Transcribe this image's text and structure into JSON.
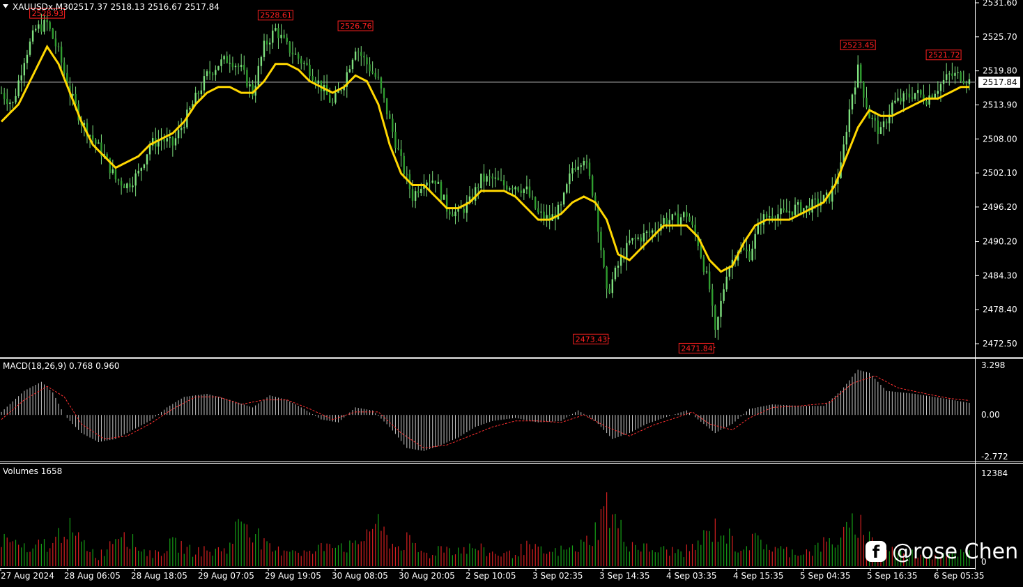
{
  "header": {
    "symbol": "XAUUSDx,M30",
    "ohlc": "2517.37 2518.13 2516.67 2517.84"
  },
  "colors": {
    "background": "#000000",
    "bull": "#2f9e2f",
    "candle": "#7ee07e",
    "ma": "#ffd700",
    "label_red": "#ff2020",
    "macd_hist": "#c8c8c8",
    "macd_signal": "#ff3030",
    "vol_up": "#16a016",
    "vol_down": "#d62020",
    "grid": "#ffffff"
  },
  "price_panel": {
    "axis_labels": [
      "2531.60",
      "2525.70",
      "2519.80",
      "2513.90",
      "2508.00",
      "2502.10",
      "2496.20",
      "2490.20",
      "2484.30",
      "2478.40",
      "2472.50"
    ],
    "current_price": "2517.84",
    "extremes": [
      {
        "label": "2528.93",
        "value": 2528.93,
        "index": 16
      },
      {
        "label": "2528.61",
        "value": 2528.61,
        "index": 96
      },
      {
        "label": "2526.76",
        "value": 2526.76,
        "index": 124
      },
      {
        "label": "2473.43",
        "value": 2473.43,
        "index": 213
      },
      {
        "label": "2471.84",
        "value": 2471.84,
        "index": 250
      },
      {
        "label": "2523.45",
        "value": 2523.45,
        "index": 300
      },
      {
        "label": "2521.72",
        "value": 2521.72,
        "index": 330
      }
    ]
  },
  "macd_panel": {
    "title": "MACD(18,26,9) 0.768 0.960",
    "axis_labels": [
      "3.298",
      "0.00",
      "-2.772"
    ]
  },
  "volume_panel": {
    "title": "Volumes 1658",
    "axis_labels": [
      "12384",
      "0"
    ]
  },
  "time_axis": [
    "27 Aug 2024",
    "28 Aug 06:05",
    "28 Aug 18:05",
    "29 Aug 07:05",
    "29 Aug 19:05",
    "30 Aug 08:05",
    "30 Aug 20:05",
    "2 Sep 10:05",
    "3 Sep 02:35",
    "3 Sep 14:35",
    "4 Sep 03:35",
    "4 Sep 15:35",
    "5 Sep 04:35",
    "5 Sep 16:35",
    "6 Sep 05:35"
  ],
  "watermark": {
    "icon": "facebook-icon",
    "text": "@rose Chen"
  },
  "chart_data": {
    "type": "line",
    "title": "XAUUSDx,M30",
    "ylim": [
      2469.0,
      2531.6
    ],
    "price_keypoints": [
      [
        0,
        2516
      ],
      [
        4,
        2514
      ],
      [
        8,
        2522
      ],
      [
        12,
        2527
      ],
      [
        16,
        2528
      ],
      [
        20,
        2523
      ],
      [
        24,
        2516
      ],
      [
        28,
        2511
      ],
      [
        32,
        2508
      ],
      [
        36,
        2505
      ],
      [
        40,
        2501
      ],
      [
        44,
        2500
      ],
      [
        48,
        2502
      ],
      [
        52,
        2507
      ],
      [
        56,
        2508
      ],
      [
        60,
        2507
      ],
      [
        64,
        2511
      ],
      [
        68,
        2515
      ],
      [
        72,
        2519
      ],
      [
        76,
        2521
      ],
      [
        80,
        2522
      ],
      [
        84,
        2520
      ],
      [
        88,
        2516
      ],
      [
        92,
        2524
      ],
      [
        96,
        2527
      ],
      [
        100,
        2524
      ],
      [
        104,
        2522
      ],
      [
        108,
        2520
      ],
      [
        112,
        2517
      ],
      [
        116,
        2514
      ],
      [
        120,
        2518
      ],
      [
        124,
        2524
      ],
      [
        128,
        2521
      ],
      [
        132,
        2518
      ],
      [
        136,
        2511
      ],
      [
        140,
        2504
      ],
      [
        144,
        2498
      ],
      [
        148,
        2501
      ],
      [
        152,
        2501
      ],
      [
        156,
        2496
      ],
      [
        160,
        2495
      ],
      [
        164,
        2497
      ],
      [
        168,
        2501
      ],
      [
        172,
        2501
      ],
      [
        176,
        2500
      ],
      [
        180,
        2500
      ],
      [
        184,
        2499
      ],
      [
        188,
        2495
      ],
      [
        192,
        2494
      ],
      [
        196,
        2496
      ],
      [
        200,
        2503
      ],
      [
        204,
        2505
      ],
      [
        208,
        2497
      ],
      [
        212,
        2481
      ],
      [
        216,
        2486
      ],
      [
        220,
        2490
      ],
      [
        224,
        2491
      ],
      [
        228,
        2492
      ],
      [
        232,
        2494
      ],
      [
        236,
        2494
      ],
      [
        240,
        2495
      ],
      [
        244,
        2490
      ],
      [
        248,
        2482
      ],
      [
        250,
        2474
      ],
      [
        254,
        2485
      ],
      [
        258,
        2489
      ],
      [
        262,
        2488
      ],
      [
        266,
        2494
      ],
      [
        270,
        2495
      ],
      [
        274,
        2495
      ],
      [
        278,
        2496
      ],
      [
        282,
        2496
      ],
      [
        286,
        2497
      ],
      [
        290,
        2498
      ],
      [
        294,
        2503
      ],
      [
        296,
        2510
      ],
      [
        298,
        2516
      ],
      [
        300,
        2520
      ],
      [
        304,
        2512
      ],
      [
        308,
        2509
      ],
      [
        312,
        2514
      ],
      [
        316,
        2515
      ],
      [
        320,
        2516
      ],
      [
        324,
        2515
      ],
      [
        328,
        2517
      ],
      [
        332,
        2519
      ],
      [
        336,
        2519
      ],
      [
        339,
        2518
      ]
    ],
    "ma_keypoints": [
      [
        0,
        2511
      ],
      [
        6,
        2514
      ],
      [
        12,
        2520
      ],
      [
        16,
        2524
      ],
      [
        20,
        2521
      ],
      [
        24,
        2516
      ],
      [
        28,
        2511
      ],
      [
        32,
        2507
      ],
      [
        36,
        2505
      ],
      [
        40,
        2503
      ],
      [
        44,
        2504
      ],
      [
        48,
        2505
      ],
      [
        52,
        2507
      ],
      [
        56,
        2508
      ],
      [
        60,
        2509
      ],
      [
        64,
        2511
      ],
      [
        68,
        2514
      ],
      [
        72,
        2516
      ],
      [
        76,
        2517
      ],
      [
        80,
        2517
      ],
      [
        84,
        2516
      ],
      [
        88,
        2516
      ],
      [
        92,
        2518
      ],
      [
        96,
        2521
      ],
      [
        100,
        2521
      ],
      [
        104,
        2520
      ],
      [
        108,
        2518
      ],
      [
        112,
        2517
      ],
      [
        116,
        2516
      ],
      [
        120,
        2517
      ],
      [
        124,
        2519
      ],
      [
        128,
        2518
      ],
      [
        132,
        2514
      ],
      [
        136,
        2507
      ],
      [
        140,
        2502
      ],
      [
        144,
        2500
      ],
      [
        148,
        2500
      ],
      [
        152,
        2498
      ],
      [
        156,
        2496
      ],
      [
        160,
        2496
      ],
      [
        164,
        2497
      ],
      [
        168,
        2499
      ],
      [
        172,
        2499
      ],
      [
        176,
        2499
      ],
      [
        180,
        2498
      ],
      [
        184,
        2496
      ],
      [
        188,
        2494
      ],
      [
        192,
        2494
      ],
      [
        196,
        2495
      ],
      [
        200,
        2497
      ],
      [
        204,
        2498
      ],
      [
        208,
        2497
      ],
      [
        212,
        2494
      ],
      [
        216,
        2488
      ],
      [
        220,
        2487
      ],
      [
        224,
        2489
      ],
      [
        228,
        2491
      ],
      [
        232,
        2493
      ],
      [
        236,
        2493
      ],
      [
        240,
        2493
      ],
      [
        244,
        2491
      ],
      [
        248,
        2487
      ],
      [
        252,
        2485
      ],
      [
        256,
        2486
      ],
      [
        260,
        2490
      ],
      [
        264,
        2493
      ],
      [
        268,
        2494
      ],
      [
        272,
        2494
      ],
      [
        276,
        2494
      ],
      [
        280,
        2495
      ],
      [
        284,
        2496
      ],
      [
        288,
        2497
      ],
      [
        292,
        2500
      ],
      [
        296,
        2505
      ],
      [
        300,
        2510
      ],
      [
        304,
        2513
      ],
      [
        308,
        2512
      ],
      [
        312,
        2512
      ],
      [
        316,
        2513
      ],
      [
        320,
        2514
      ],
      [
        324,
        2515
      ],
      [
        328,
        2515
      ],
      [
        332,
        2516
      ],
      [
        336,
        2517
      ],
      [
        339,
        2517
      ]
    ],
    "macd_keypoints": [
      [
        0,
        0.2
      ],
      [
        8,
        1.6
      ],
      [
        14,
        2.2
      ],
      [
        18,
        1.5
      ],
      [
        22,
        0.0
      ],
      [
        28,
        -1.2
      ],
      [
        34,
        -1.8
      ],
      [
        40,
        -1.6
      ],
      [
        46,
        -1.0
      ],
      [
        52,
        -0.4
      ],
      [
        58,
        0.5
      ],
      [
        64,
        1.2
      ],
      [
        72,
        1.4
      ],
      [
        80,
        1.0
      ],
      [
        88,
        0.5
      ],
      [
        94,
        1.3
      ],
      [
        100,
        1.0
      ],
      [
        106,
        0.4
      ],
      [
        112,
        -0.3
      ],
      [
        118,
        -0.5
      ],
      [
        124,
        0.5
      ],
      [
        130,
        0.3
      ],
      [
        136,
        -0.8
      ],
      [
        142,
        -2.2
      ],
      [
        148,
        -2.4
      ],
      [
        154,
        -2.0
      ],
      [
        160,
        -1.5
      ],
      [
        166,
        -0.8
      ],
      [
        172,
        -0.4
      ],
      [
        180,
        -0.2
      ],
      [
        188,
        -0.5
      ],
      [
        196,
        -0.4
      ],
      [
        202,
        0.3
      ],
      [
        208,
        -0.4
      ],
      [
        214,
        -1.6
      ],
      [
        220,
        -1.2
      ],
      [
        226,
        -0.6
      ],
      [
        232,
        -0.2
      ],
      [
        240,
        0.3
      ],
      [
        244,
        -0.3
      ],
      [
        250,
        -1.2
      ],
      [
        256,
        -0.6
      ],
      [
        262,
        0.4
      ],
      [
        270,
        0.7
      ],
      [
        280,
        0.6
      ],
      [
        288,
        0.6
      ],
      [
        294,
        1.6
      ],
      [
        300,
        3.0
      ],
      [
        304,
        2.8
      ],
      [
        310,
        1.6
      ],
      [
        320,
        1.4
      ],
      [
        330,
        1.1
      ],
      [
        339,
        0.8
      ]
    ],
    "signal_keypoints": [
      [
        0,
        -0.3
      ],
      [
        8,
        1.0
      ],
      [
        16,
        1.9
      ],
      [
        22,
        1.2
      ],
      [
        28,
        -0.6
      ],
      [
        36,
        -1.6
      ],
      [
        44,
        -1.4
      ],
      [
        52,
        -0.6
      ],
      [
        60,
        0.4
      ],
      [
        68,
        1.2
      ],
      [
        76,
        1.2
      ],
      [
        84,
        0.7
      ],
      [
        92,
        1.0
      ],
      [
        100,
        1.0
      ],
      [
        108,
        0.4
      ],
      [
        116,
        -0.3
      ],
      [
        124,
        0.2
      ],
      [
        132,
        0.2
      ],
      [
        140,
        -1.2
      ],
      [
        148,
        -2.2
      ],
      [
        156,
        -2.0
      ],
      [
        164,
        -1.4
      ],
      [
        172,
        -0.8
      ],
      [
        180,
        -0.4
      ],
      [
        188,
        -0.4
      ],
      [
        196,
        -0.5
      ],
      [
        204,
        0.0
      ],
      [
        212,
        -0.8
      ],
      [
        220,
        -1.4
      ],
      [
        228,
        -0.7
      ],
      [
        236,
        -0.2
      ],
      [
        242,
        0.2
      ],
      [
        248,
        -0.6
      ],
      [
        256,
        -1.0
      ],
      [
        262,
        -0.2
      ],
      [
        270,
        0.5
      ],
      [
        280,
        0.6
      ],
      [
        290,
        0.8
      ],
      [
        298,
        2.1
      ],
      [
        306,
        2.6
      ],
      [
        314,
        1.8
      ],
      [
        324,
        1.4
      ],
      [
        332,
        1.1
      ],
      [
        339,
        0.96
      ]
    ],
    "volume_keypoints": [
      [
        0,
        3500
      ],
      [
        6,
        2800
      ],
      [
        10,
        1500
      ],
      [
        14,
        3000
      ],
      [
        18,
        2500
      ],
      [
        22,
        5500
      ],
      [
        26,
        3500
      ],
      [
        30,
        2600
      ],
      [
        34,
        1200
      ],
      [
        38,
        3000
      ],
      [
        42,
        5200
      ],
      [
        46,
        3000
      ],
      [
        50,
        2000
      ],
      [
        54,
        1500
      ],
      [
        58,
        2600
      ],
      [
        62,
        2800
      ],
      [
        66,
        2000
      ],
      [
        70,
        2000
      ],
      [
        74,
        1800
      ],
      [
        80,
        2600
      ],
      [
        84,
        6500
      ],
      [
        88,
        5000
      ],
      [
        92,
        2600
      ],
      [
        96,
        1800
      ],
      [
        100,
        2400
      ],
      [
        104,
        2000
      ],
      [
        108,
        1600
      ],
      [
        112,
        2400
      ],
      [
        116,
        3500
      ],
      [
        120,
        2600
      ],
      [
        124,
        2400
      ],
      [
        130,
        5500
      ],
      [
        134,
        4200
      ],
      [
        138,
        2400
      ],
      [
        142,
        3200
      ],
      [
        146,
        2000
      ],
      [
        150,
        1400
      ],
      [
        154,
        2500
      ],
      [
        158,
        2200
      ],
      [
        162,
        2200
      ],
      [
        166,
        2400
      ],
      [
        170,
        1800
      ],
      [
        174,
        1600
      ],
      [
        178,
        1500
      ],
      [
        184,
        2400
      ],
      [
        188,
        2000
      ],
      [
        192,
        1600
      ],
      [
        196,
        2000
      ],
      [
        200,
        2200
      ],
      [
        204,
        2800
      ],
      [
        208,
        4500
      ],
      [
        212,
        7800
      ],
      [
        216,
        5000
      ],
      [
        220,
        3000
      ],
      [
        226,
        2200
      ],
      [
        230,
        2000
      ],
      [
        234,
        2000
      ],
      [
        238,
        1800
      ],
      [
        242,
        2200
      ],
      [
        246,
        3600
      ],
      [
        250,
        4800
      ],
      [
        254,
        4000
      ],
      [
        258,
        2400
      ],
      [
        262,
        3000
      ],
      [
        266,
        3400
      ],
      [
        270,
        2200
      ],
      [
        274,
        2000
      ],
      [
        278,
        1800
      ],
      [
        284,
        2000
      ],
      [
        288,
        2800
      ],
      [
        292,
        3200
      ],
      [
        296,
        4200
      ],
      [
        300,
        5800
      ],
      [
        304,
        3600
      ],
      [
        308,
        2400
      ],
      [
        312,
        2200
      ],
      [
        316,
        1800
      ],
      [
        320,
        1600
      ],
      [
        326,
        1400
      ],
      [
        332,
        1800
      ],
      [
        339,
        1658
      ]
    ]
  }
}
